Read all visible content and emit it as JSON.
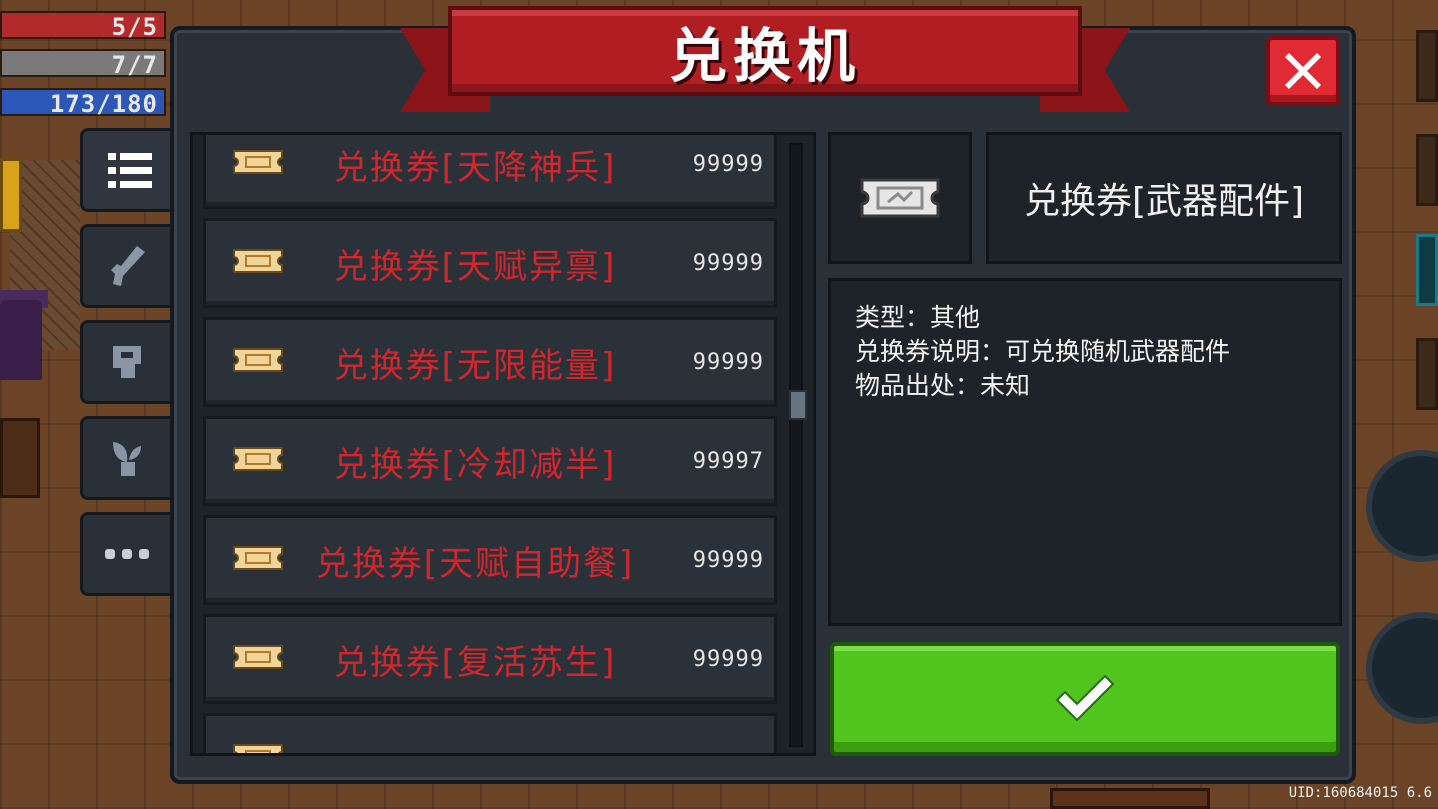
{
  "hud": {
    "hp": "5/5",
    "armor": "7/7",
    "energy": "173/180"
  },
  "dialog": {
    "title": "兑换机",
    "tabs": [
      {
        "icon": "list-icon",
        "active": true
      },
      {
        "icon": "gun-icon",
        "active": false
      },
      {
        "icon": "helmet-icon",
        "active": false
      },
      {
        "icon": "plant-icon",
        "active": false
      },
      {
        "icon": "more-icon",
        "active": false
      }
    ],
    "items": [
      {
        "name": "兑换券[天降神兵]",
        "count": "99999"
      },
      {
        "name": "兑换券[天赋异禀]",
        "count": "99999"
      },
      {
        "name": "兑换券[无限能量]",
        "count": "99999"
      },
      {
        "name": "兑换券[冷却减半]",
        "count": "99997"
      },
      {
        "name": "兑换券[天赋自助餐]",
        "count": "99999"
      },
      {
        "name": "兑换券[复活苏生]",
        "count": "99999"
      },
      {
        "name": "",
        "count": ""
      }
    ],
    "scroll_position": 0.43,
    "selected": {
      "name": "兑换券[武器配件]",
      "details": [
        "类型：其他",
        "兑换券说明：可兑换随机武器配件",
        "物品出处：未知"
      ]
    }
  },
  "uid_text": "UID:160684015 6.6",
  "colors": {
    "item_name": "#d0262c",
    "banner": "#b01e24",
    "confirm": "#52c41e",
    "close": "#e02a34",
    "panel": "#2a3038"
  }
}
